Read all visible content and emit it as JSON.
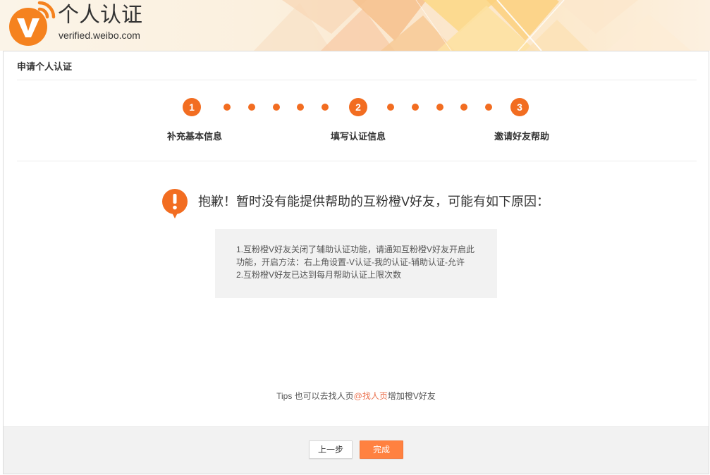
{
  "header": {
    "title": "个人认证",
    "domain": "verified.weibo.com"
  },
  "panel": {
    "title": "申请个人认证"
  },
  "steps": [
    {
      "number": "1",
      "label": "补充基本信息"
    },
    {
      "number": "2",
      "label": "填写认证信息"
    },
    {
      "number": "3",
      "label": "邀请好友帮助"
    }
  ],
  "notice": {
    "message": "抱歉！暂时没有能提供帮助的互粉橙V好友，可能有如下原因：",
    "reason_lines": [
      "1.互粉橙V好友关闭了辅助认证功能，请通知互粉橙V好友开启此",
      "功能，开启方法：右上角设置-V认证-我的认证-辅助认证-允许",
      "2.互粉橙V好友已达到每月帮助认证上限次数"
    ]
  },
  "tips": {
    "prefix": "Tips 也可以去找人页",
    "link": "@找人页",
    "suffix": "增加橙V好友"
  },
  "footer": {
    "back_label": "上一步",
    "finish_label": "完成"
  },
  "icons": {
    "logo": "verified-v-logo-icon",
    "notice": "warning-icon"
  },
  "colors": {
    "accent": "#f26d21",
    "finish_button": "#ff8140",
    "link": "#eb7350",
    "notice_box": "#f2f2f2",
    "logo": "#f5821f"
  }
}
